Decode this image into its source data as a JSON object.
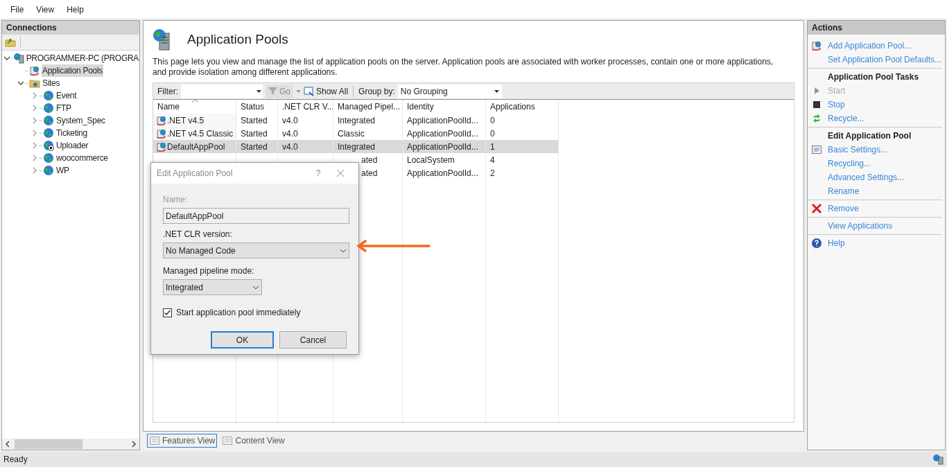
{
  "menu": [
    "File",
    "View",
    "Help"
  ],
  "connections": {
    "title": "Connections",
    "tree": [
      {
        "label": "PROGRAMMER-PC (PROGRA",
        "kind": "server",
        "expanded": true,
        "selected": false,
        "children": [
          {
            "label": "Application Pools",
            "kind": "pools",
            "selected": true
          },
          {
            "label": "Sites",
            "kind": "folder",
            "expanded": true,
            "selected": false,
            "children": [
              {
                "label": "Event",
                "kind": "site",
                "expanded": false,
                "selected": false,
                "stopped": false
              },
              {
                "label": "FTP",
                "kind": "site",
                "expanded": false,
                "selected": false,
                "stopped": false
              },
              {
                "label": "System_Spec",
                "kind": "site",
                "expanded": false,
                "selected": false,
                "stopped": false
              },
              {
                "label": "Ticketing",
                "kind": "site",
                "expanded": false,
                "selected": false,
                "stopped": false
              },
              {
                "label": "Uploader",
                "kind": "site",
                "expanded": false,
                "selected": false,
                "stopped": true
              },
              {
                "label": "woocommerce",
                "kind": "site",
                "expanded": false,
                "selected": false,
                "stopped": false
              },
              {
                "label": "WP",
                "kind": "site",
                "expanded": false,
                "selected": false,
                "stopped": false
              }
            ]
          }
        ]
      }
    ]
  },
  "page": {
    "title": "Application Pools",
    "description": "This page lets you view and manage the list of application pools on the server. Application pools are associated with worker processes, contain one or more applications, and provide isolation among different applications.",
    "filter_label": "Filter:",
    "go": "Go",
    "show_all": "Show All",
    "group_by_label": "Group by:",
    "group_by": "No Grouping",
    "columns": [
      "Name",
      "Status",
      ".NET CLR V...",
      "Managed Pipel...",
      "Identity",
      "Applications"
    ],
    "rows": [
      {
        "covered": false,
        "selected": false,
        "cells": [
          ".NET v4.5",
          "Started",
          "v4.0",
          "Integrated",
          "ApplicationPoolId...",
          "0"
        ]
      },
      {
        "covered": false,
        "selected": false,
        "cells": [
          ".NET v4.5 Classic",
          "Started",
          "v4.0",
          "Classic",
          "ApplicationPoolId...",
          "0"
        ]
      },
      {
        "covered": false,
        "selected": true,
        "cells": [
          "DefaultAppPool",
          "Started",
          "v4.0",
          "Integrated",
          "ApplicationPoolId...",
          "1"
        ]
      },
      {
        "covered": true,
        "selected": false,
        "cells": [
          "",
          "",
          "",
          "ated",
          "LocalSystem",
          "4"
        ]
      },
      {
        "covered": true,
        "selected": false,
        "cells": [
          "",
          "",
          "",
          "ated",
          "ApplicationPoolId...",
          "2"
        ]
      }
    ],
    "view_tabs": [
      {
        "label": "Features View",
        "selected": true
      },
      {
        "label": "Content View",
        "selected": false
      }
    ]
  },
  "dialog": {
    "title": "Edit Application Pool",
    "help": "?",
    "name_label": "Name:",
    "name_value": "DefaultAppPool",
    "clr_label": ".NET CLR version:",
    "clr_value": "No Managed Code",
    "pipeline_label": "Managed pipeline mode:",
    "pipeline_value": "Integrated",
    "start_label": "Start application pool immediately",
    "start_checked": true,
    "ok": "OK",
    "cancel": "Cancel"
  },
  "actions": {
    "title": "Actions",
    "sections": [
      {
        "items": [
          {
            "kind": "add",
            "label": "Add Application Pool...",
            "disabled": false
          },
          {
            "kind": "plain",
            "label": "Set Application Pool Defaults...",
            "disabled": false
          }
        ]
      },
      {
        "heading": "Application Pool Tasks",
        "items": [
          {
            "kind": "start",
            "label": "Start",
            "disabled": true
          },
          {
            "kind": "stop",
            "label": "Stop",
            "disabled": false
          },
          {
            "kind": "recycle",
            "label": "Recycle...",
            "disabled": false
          }
        ]
      },
      {
        "heading": "Edit Application Pool",
        "items": [
          {
            "kind": "settings",
            "label": "Basic Settings...",
            "disabled": false
          },
          {
            "kind": "plain",
            "label": "Recycling...",
            "disabled": false
          },
          {
            "kind": "plain",
            "label": "Advanced Settings...",
            "disabled": false
          },
          {
            "kind": "plain",
            "label": "Rename",
            "disabled": false
          }
        ]
      },
      {
        "items": [
          {
            "kind": "remove",
            "label": "Remove",
            "disabled": false
          }
        ]
      },
      {
        "items": [
          {
            "kind": "plain",
            "label": "View Applications",
            "disabled": false
          }
        ]
      },
      {
        "items": [
          {
            "kind": "help",
            "label": "Help",
            "disabled": false
          }
        ]
      }
    ]
  },
  "status": "Ready"
}
